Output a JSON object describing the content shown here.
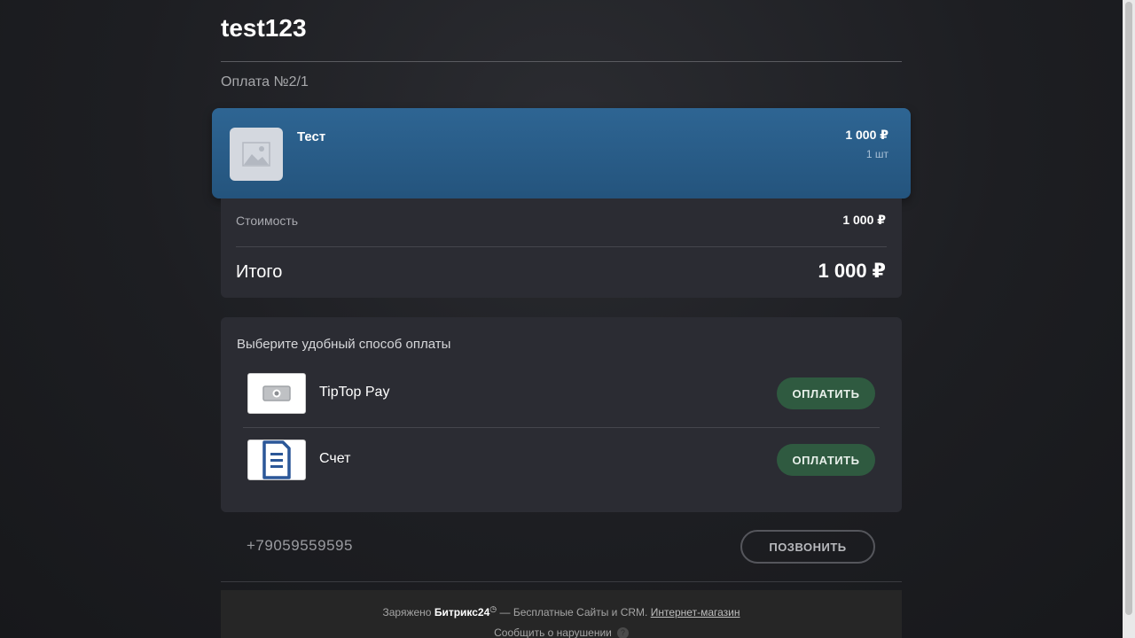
{
  "header": {
    "title": "test123",
    "payment_number": "Оплата №2/1"
  },
  "product": {
    "name": "Тест",
    "price": "1 000 ₽",
    "quantity": "1 шт"
  },
  "summary": {
    "cost_label": "Стоимость",
    "cost_value": "1 000 ₽",
    "total_label": "Итого",
    "total_value": "1 000 ₽"
  },
  "payment_methods": {
    "title": "Выберите удобный способ оплаты",
    "items": [
      {
        "name": "TipTop Pay",
        "button": "ОПЛАТИТЬ",
        "icon": "cash-icon"
      },
      {
        "name": "Счет",
        "button": "ОПЛАТИТЬ",
        "icon": "invoice-icon"
      }
    ]
  },
  "contact": {
    "phone": "+79059559595",
    "call_button": "ПОЗВОНИТЬ"
  },
  "footer": {
    "powered_prefix": "Заряжено",
    "brand": "Битрикс24",
    "middle": "— Бесплатные Сайты и CRM.",
    "link": "Интернет-магазин",
    "report": "Сообщить о нарушении",
    "help": "?"
  },
  "colors": {
    "product_card": "#2a5d8a",
    "pay_button": "#2f5a40",
    "panel": "#2b2c33"
  }
}
